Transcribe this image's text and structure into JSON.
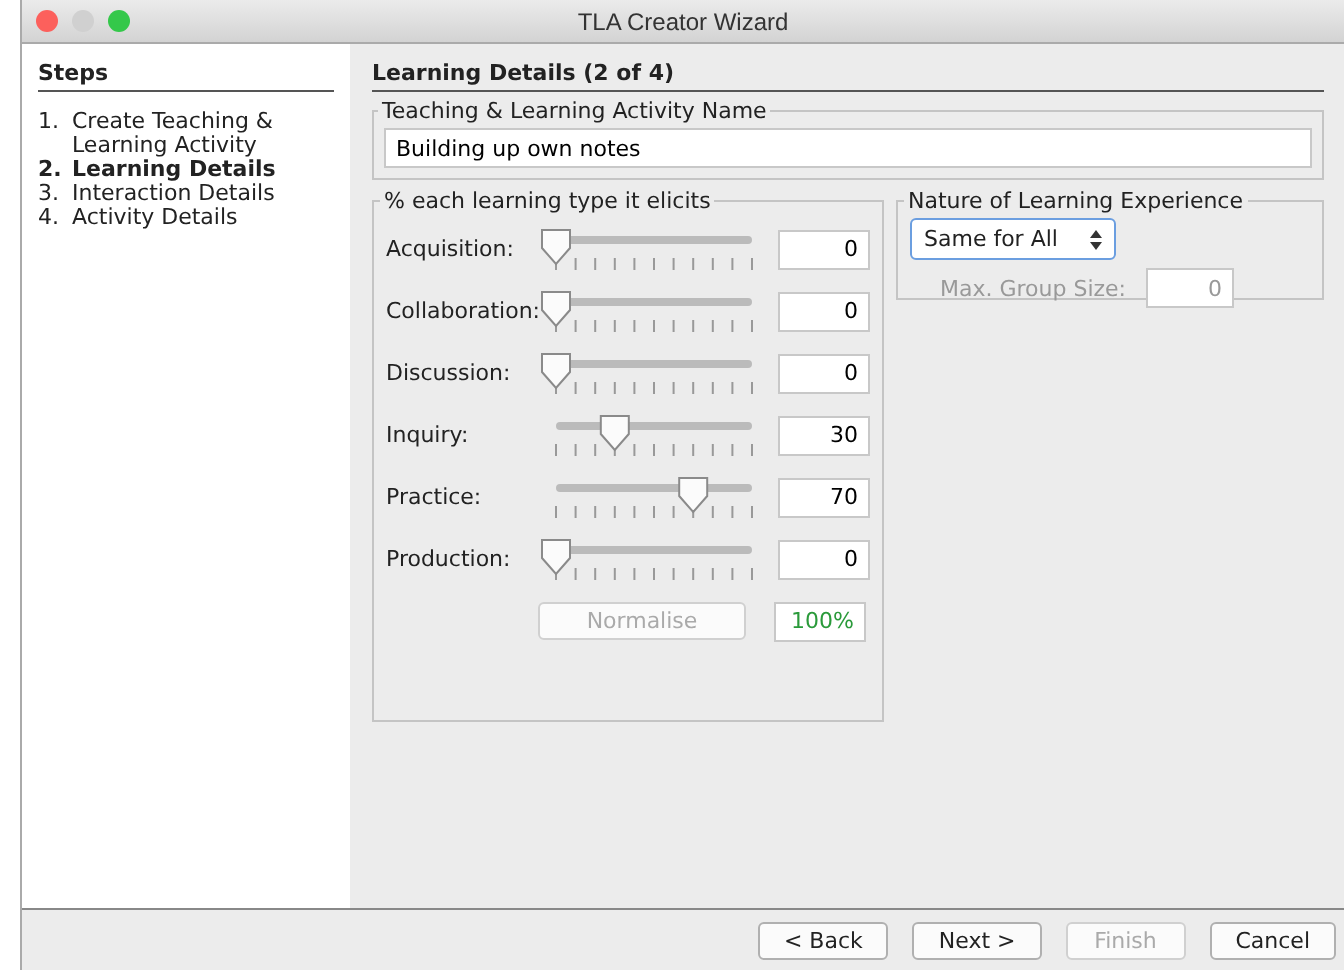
{
  "window": {
    "title": "TLA Creator Wizard"
  },
  "steps": {
    "title": "Steps",
    "items": [
      {
        "number": "1.",
        "label": "Create Teaching & Learning Activity",
        "selected": false
      },
      {
        "number": "2.",
        "label": "Learning Details",
        "selected": true
      },
      {
        "number": "3.",
        "label": "Interaction Details",
        "selected": false
      },
      {
        "number": "4.",
        "label": "Activity Details",
        "selected": false
      }
    ]
  },
  "page_title": "Learning Details (2 of 4)",
  "name_group": {
    "title": "Teaching & Learning Activity Name",
    "value": "Building up own notes"
  },
  "types_group": {
    "title": "% each learning type it elicits",
    "rows": [
      {
        "label": "Acquisition:",
        "level": 0,
        "value": "0"
      },
      {
        "label": "Collaboration:",
        "level": 0,
        "value": "0"
      },
      {
        "label": "Discussion:",
        "level": 0,
        "value": "0"
      },
      {
        "label": "Inquiry:",
        "level": 0.3,
        "value": "30"
      },
      {
        "label": "Practice:",
        "level": 0.7,
        "value": "70"
      },
      {
        "label": "Production:",
        "level": 0,
        "value": "0"
      }
    ],
    "normalise": {
      "label": "Normalise",
      "disabled": true
    },
    "total": "100%"
  },
  "nature_group": {
    "title": "Nature of Learning Experience",
    "select": "Same for All",
    "group_size_label": "Max. Group Size:",
    "group_size": "0",
    "group_size_disabled": true
  },
  "buttons": [
    {
      "label": "< Back",
      "disabled": false
    },
    {
      "label": "Next >",
      "disabled": false
    },
    {
      "label": "Finish",
      "disabled": true
    },
    {
      "label": "Cancel",
      "disabled": false
    }
  ]
}
